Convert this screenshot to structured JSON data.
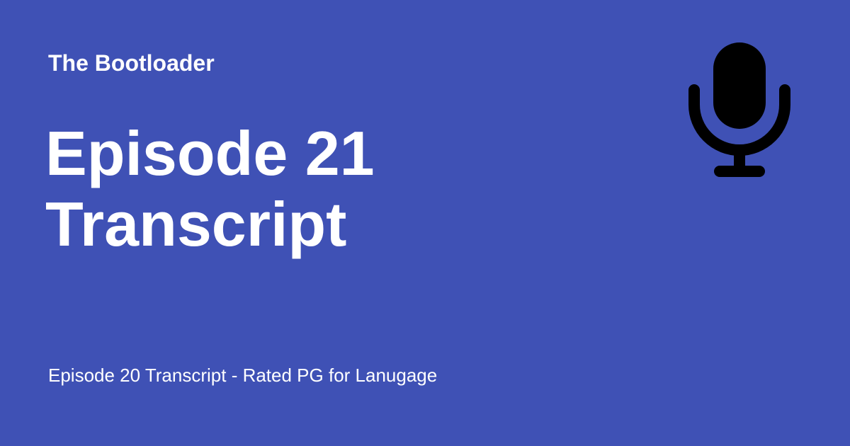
{
  "site": {
    "name": "The Bootloader"
  },
  "episode": {
    "title_line1": "Episode 21",
    "title_line2": "Transcript",
    "description": "Episode 20 Transcript - Rated PG for Lanugage"
  },
  "colors": {
    "background": "#3f51b5",
    "text": "#ffffff",
    "icon": "#000000"
  },
  "icon": {
    "name": "microphone-icon"
  }
}
